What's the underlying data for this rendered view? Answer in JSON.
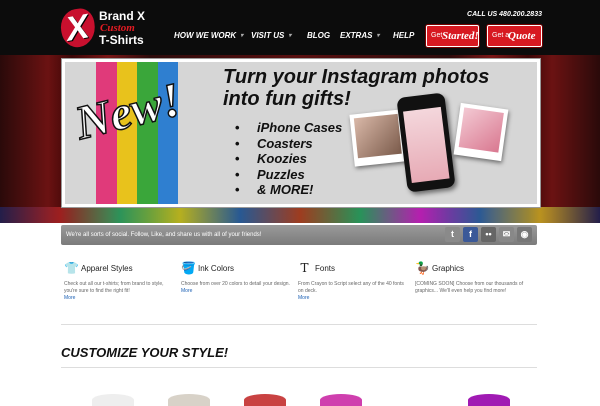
{
  "logo": {
    "line1": "Brand X",
    "line2": "Custom",
    "line3": "T-Shirts",
    "mark": "X"
  },
  "header": {
    "call": "CALL US 480.200.2833"
  },
  "nav": [
    {
      "label": "HOW WE WORK",
      "caret": "▾"
    },
    {
      "label": "VISIT US",
      "caret": "▾"
    },
    {
      "label": "BLOG"
    },
    {
      "label": "EXTRAS",
      "caret": "▾"
    },
    {
      "label": "HELP"
    }
  ],
  "cta": {
    "started": {
      "pre": "Get",
      "main": "Started!"
    },
    "quote": {
      "pre": "Get a",
      "main": "Quote"
    }
  },
  "slide": {
    "badge": "New!",
    "title_line1": "Turn your Instagram photos",
    "title_line2": "into fun gifts!",
    "items": [
      "iPhone Cases",
      "Coasters",
      "Koozies",
      "Puzzles",
      "& MORE!"
    ],
    "stripe_colors": [
      "#e03a7a",
      "#e8c21c",
      "#3aa63a",
      "#2f7fd0"
    ]
  },
  "social": {
    "text": "We're all sorts of social. Follow, Like, and share us with all of your friends!",
    "icons": [
      {
        "name": "twitter-icon",
        "glyph": "t",
        "color": "#8a8a8a"
      },
      {
        "name": "facebook-icon",
        "glyph": "f",
        "color": "#3b5998"
      },
      {
        "name": "flickr-icon",
        "glyph": "••",
        "color": "#666"
      },
      {
        "name": "email-icon",
        "glyph": "✉",
        "color": "#888"
      },
      {
        "name": "rss-icon",
        "glyph": "◉",
        "color": "#777"
      }
    ]
  },
  "features": [
    {
      "icon": "👕",
      "icon_name": "tshirt-icon",
      "title": "Apparel Styles",
      "desc": "Check out all our t-shirts; from brand to style, you're sure to find the right fit!",
      "more": "More"
    },
    {
      "icon": "🪣",
      "icon_name": "ink-bucket-icon",
      "title": "Ink Colors",
      "desc": "Choose from over 20 colors to detail your design.",
      "more": "More"
    },
    {
      "icon": "T",
      "icon_name": "font-icon",
      "title": "Fonts",
      "desc": "From Crayon to Script select any of the 40 fonts on deck.",
      "more": "More"
    },
    {
      "icon": "🦆",
      "icon_name": "duck-icon",
      "title": "Graphics",
      "desc": "[COMING SOON] Choose from our thousands of graphics... We'll even help you find more!",
      "more": ""
    }
  ],
  "section": {
    "title": "CUSTOMIZE YOUR STYLE!"
  },
  "shirt_colors": [
    "#eeeeee",
    "#d8d2c8",
    "#c94242",
    "#cf3fae",
    "#a01ab3"
  ]
}
